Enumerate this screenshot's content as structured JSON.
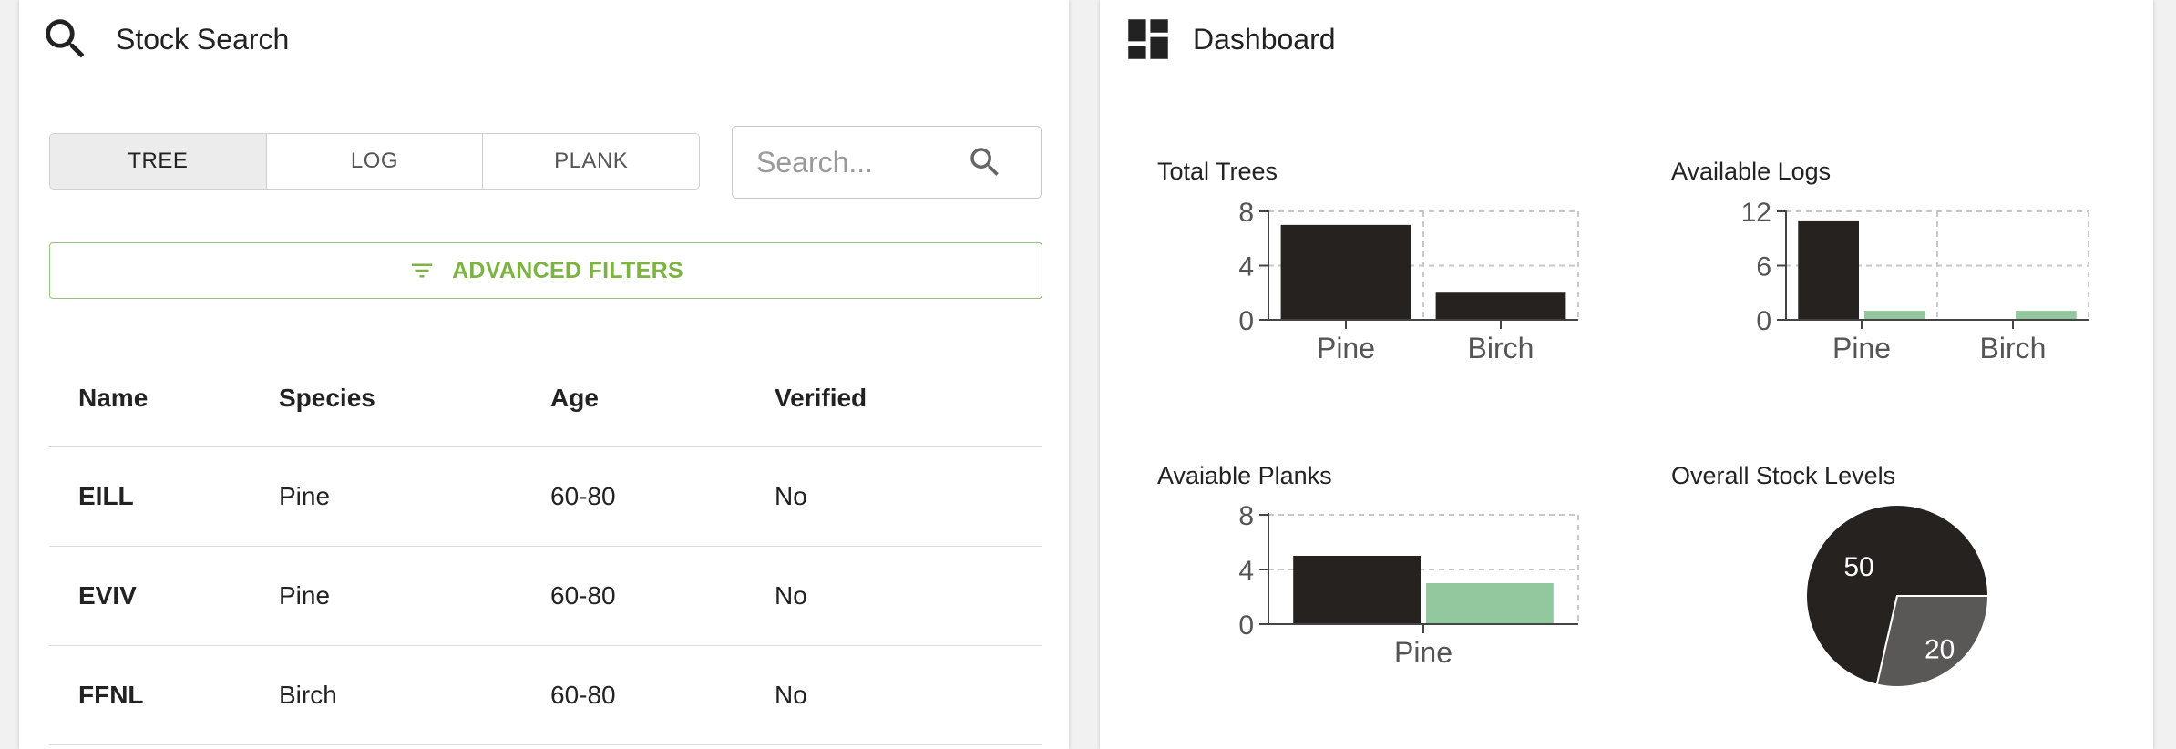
{
  "stock_search": {
    "title": "Stock Search",
    "icon": "search-icon",
    "tabs": [
      {
        "label": "TREE",
        "active": true
      },
      {
        "label": "LOG",
        "active": false
      },
      {
        "label": "PLANK",
        "active": false
      }
    ],
    "search": {
      "placeholder": "Search...",
      "value": ""
    },
    "advanced_filters_label": "ADVANCED FILTERS",
    "accent_color": "#7cb342",
    "table": {
      "headers": [
        "Name",
        "Species",
        "Age",
        "Verified"
      ],
      "rows": [
        [
          "EILL",
          "Pine",
          "60-80",
          "No"
        ],
        [
          "EVIV",
          "Pine",
          "60-80",
          "No"
        ],
        [
          "FFNL",
          "Birch",
          "60-80",
          "No"
        ]
      ]
    }
  },
  "dashboard": {
    "title": "Dashboard",
    "icon": "dashboard-icon"
  },
  "colors": {
    "dark": "#252220",
    "green": "#93c89e",
    "gray": "#5a5856"
  },
  "chart_data": [
    {
      "type": "bar",
      "title": "Total Trees",
      "categories": [
        "Pine",
        "Birch"
      ],
      "series": [
        {
          "values": [
            7,
            2
          ]
        }
      ],
      "ylim": [
        0,
        8
      ],
      "yticks": [
        0,
        4,
        8
      ],
      "grid": true
    },
    {
      "type": "bar",
      "title": "Available Logs",
      "categories": [
        "Pine",
        "Birch"
      ],
      "series": [
        {
          "values": [
            11,
            0
          ]
        },
        {
          "values": [
            1,
            1
          ]
        }
      ],
      "ylim": [
        0,
        12
      ],
      "yticks": [
        0,
        6,
        12
      ],
      "grid": true
    },
    {
      "type": "bar",
      "title": "Avaiable Planks",
      "categories": [
        "Pine"
      ],
      "series": [
        {
          "values": [
            5
          ]
        },
        {
          "values": [
            3
          ]
        }
      ],
      "ylim": [
        0,
        8
      ],
      "yticks": [
        0,
        4,
        8
      ],
      "grid": true
    },
    {
      "type": "pie",
      "title": "Overall Stock Levels",
      "values": [
        50,
        20
      ],
      "labels": [
        "50",
        "20"
      ]
    }
  ]
}
